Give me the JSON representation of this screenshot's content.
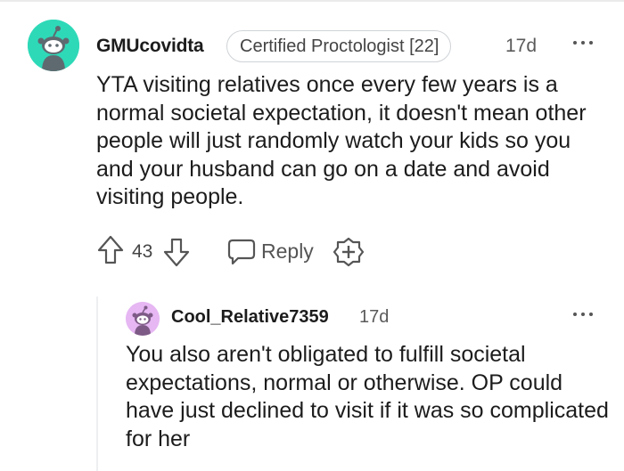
{
  "comment": {
    "author": "GMUcovidta",
    "flair": "Certified Proctologist [22]",
    "time": "17d",
    "avatar_icon": "snoo-avatar-icon",
    "avatar_color": "#2ed9b8",
    "body": "YTA visiting relatives once every few years is a normal societal expectation, it doesn't mean other people will just randomly watch your kids so you and your husband can go on a date and avoid visiting people.",
    "score": "43",
    "reply_label": "Reply",
    "icons": {
      "upvote": "arrow-up-icon",
      "downvote": "arrow-down-icon",
      "reply": "speech-bubble-icon",
      "award": "award-plus-icon",
      "more": "more-dots-icon"
    }
  },
  "reply": {
    "author": "Cool_Relative7359",
    "time": "17d",
    "avatar_icon": "snoo-avatar-icon",
    "avatar_color": "#e6b7f3",
    "body": "You also aren't obligated to fulfill societal expectations, normal or otherwise. OP could have just declined to visit if it was so complicated for her"
  }
}
